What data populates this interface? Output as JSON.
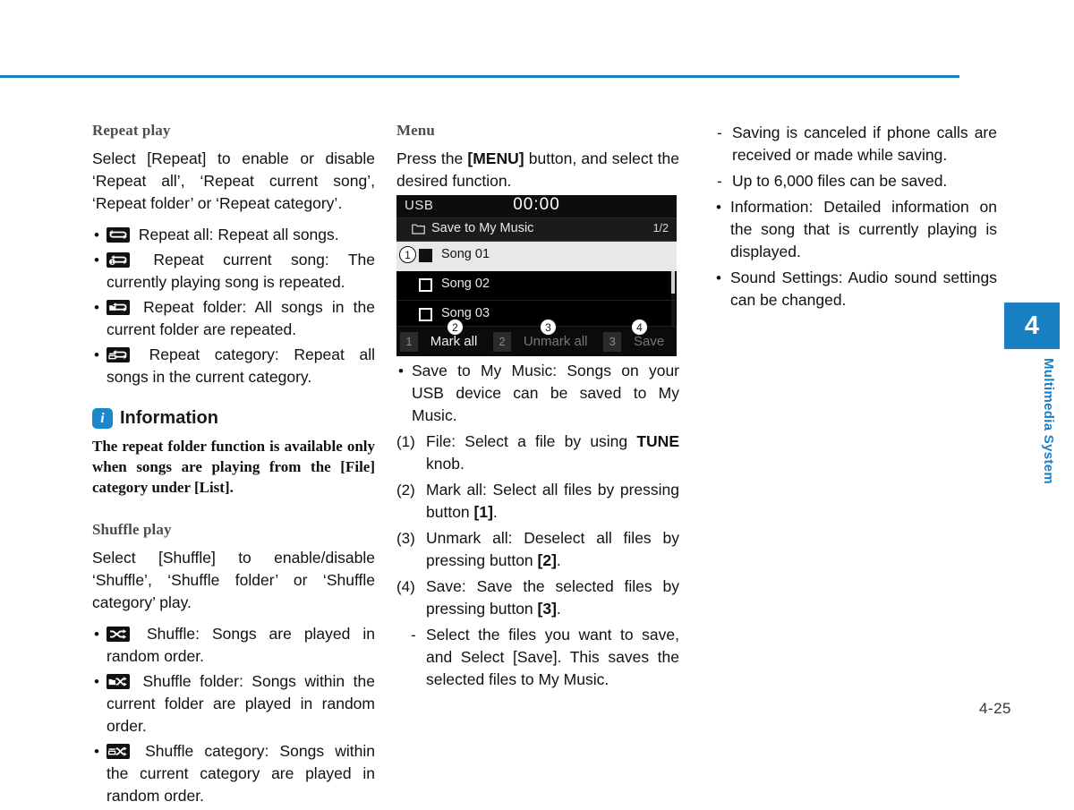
{
  "page": {
    "number": "4-25",
    "accent_color": "#1a80c4",
    "chapter_tab": {
      "number": "4",
      "label": "Multimedia System"
    }
  },
  "col1": {
    "repeat": {
      "heading": "Repeat play",
      "intro": "Select [Repeat] to enable or disable ‘Repeat all’, ‘Repeat current song’, ‘Repeat folder’ or ‘Repeat category’.",
      "items": [
        {
          "icon": "repeat-all-icon",
          "text": "Repeat all: Repeat all songs."
        },
        {
          "icon": "repeat-one-icon",
          "text": "Repeat current song: The currently playing song is repeated."
        },
        {
          "icon": "repeat-folder-icon",
          "text": "Repeat folder: All songs in the current folder are repeated."
        },
        {
          "icon": "repeat-category-icon",
          "text": "Repeat category: Repeat all songs in the current category."
        }
      ]
    },
    "information": {
      "icon": "info-icon",
      "icon_glyph": "i",
      "title": "Information",
      "body": "The repeat folder function is available only when songs are playing from the [File] category under [List]."
    },
    "shuffle": {
      "heading": "Shuffle play",
      "intro": "Select [Shuffle] to enable/disable ‘Shuffle’, ‘Shuffle folder’ or ‘Shuffle category’ play.",
      "items": [
        {
          "icon": "shuffle-icon",
          "text": "Shuffle: Songs are played in random order."
        },
        {
          "icon": "shuffle-folder-icon",
          "text": "Shuffle folder: Songs within the current folder are played in random order."
        },
        {
          "icon": "shuffle-category-icon",
          "text": "Shuffle category: Songs within the current category are played in random order."
        }
      ]
    }
  },
  "col2": {
    "menu": {
      "heading": "Menu",
      "intro_a": "Press the ",
      "intro_b": "[MENU]",
      "intro_c": " button, and select the desired function."
    },
    "device": {
      "source": "USB",
      "clock": "00:00",
      "folder_icon": "folder-icon",
      "screen_title": "Save to My Music",
      "page_indicator": "1/2",
      "rows": [
        {
          "label": "Song 01",
          "checked": true,
          "selected": true
        },
        {
          "label": "Song 02",
          "checked": false,
          "selected": false
        },
        {
          "label": "Song 03",
          "checked": false,
          "selected": false
        }
      ],
      "buttons": [
        {
          "key": "1",
          "label": "Mark all",
          "enabled": true
        },
        {
          "key": "2",
          "label": "Unmark all",
          "enabled": false
        },
        {
          "key": "3",
          "label": "Save",
          "enabled": false
        }
      ],
      "callouts": [
        "1",
        "2",
        "3",
        "4"
      ]
    },
    "notes": {
      "bullet": "Save to My Music: Songs on your USB device can be saved to My Music.",
      "numbered": [
        {
          "n": "(1)",
          "pre": "File: Select a file by using ",
          "strong": "TUNE",
          "post": " knob."
        },
        {
          "n": "(2)",
          "pre": "Mark all: Select all files by pressing button ",
          "strong": "[1]",
          "post": "."
        },
        {
          "n": "(3)",
          "pre": "Unmark all: Deselect all files by pressing button ",
          "strong": "[2]",
          "post": "."
        },
        {
          "n": "(4)",
          "pre": "Save: Save the selected files by pressing button ",
          "strong": "[3]",
          "post": "."
        }
      ],
      "dash": "Select the files you want to save, and Select [Save]. This saves the selected files to My Music."
    }
  },
  "col3": {
    "items": [
      {
        "marker": "-",
        "text": "Saving is canceled if phone calls are received or made while saving."
      },
      {
        "marker": "-",
        "text": "Up to 6,000 files can be saved."
      },
      {
        "marker": "•",
        "text": "Information: Detailed information on the song that is currently playing is displayed."
      },
      {
        "marker": "•",
        "text": "Sound Settings: Audio sound settings can be changed."
      }
    ]
  }
}
